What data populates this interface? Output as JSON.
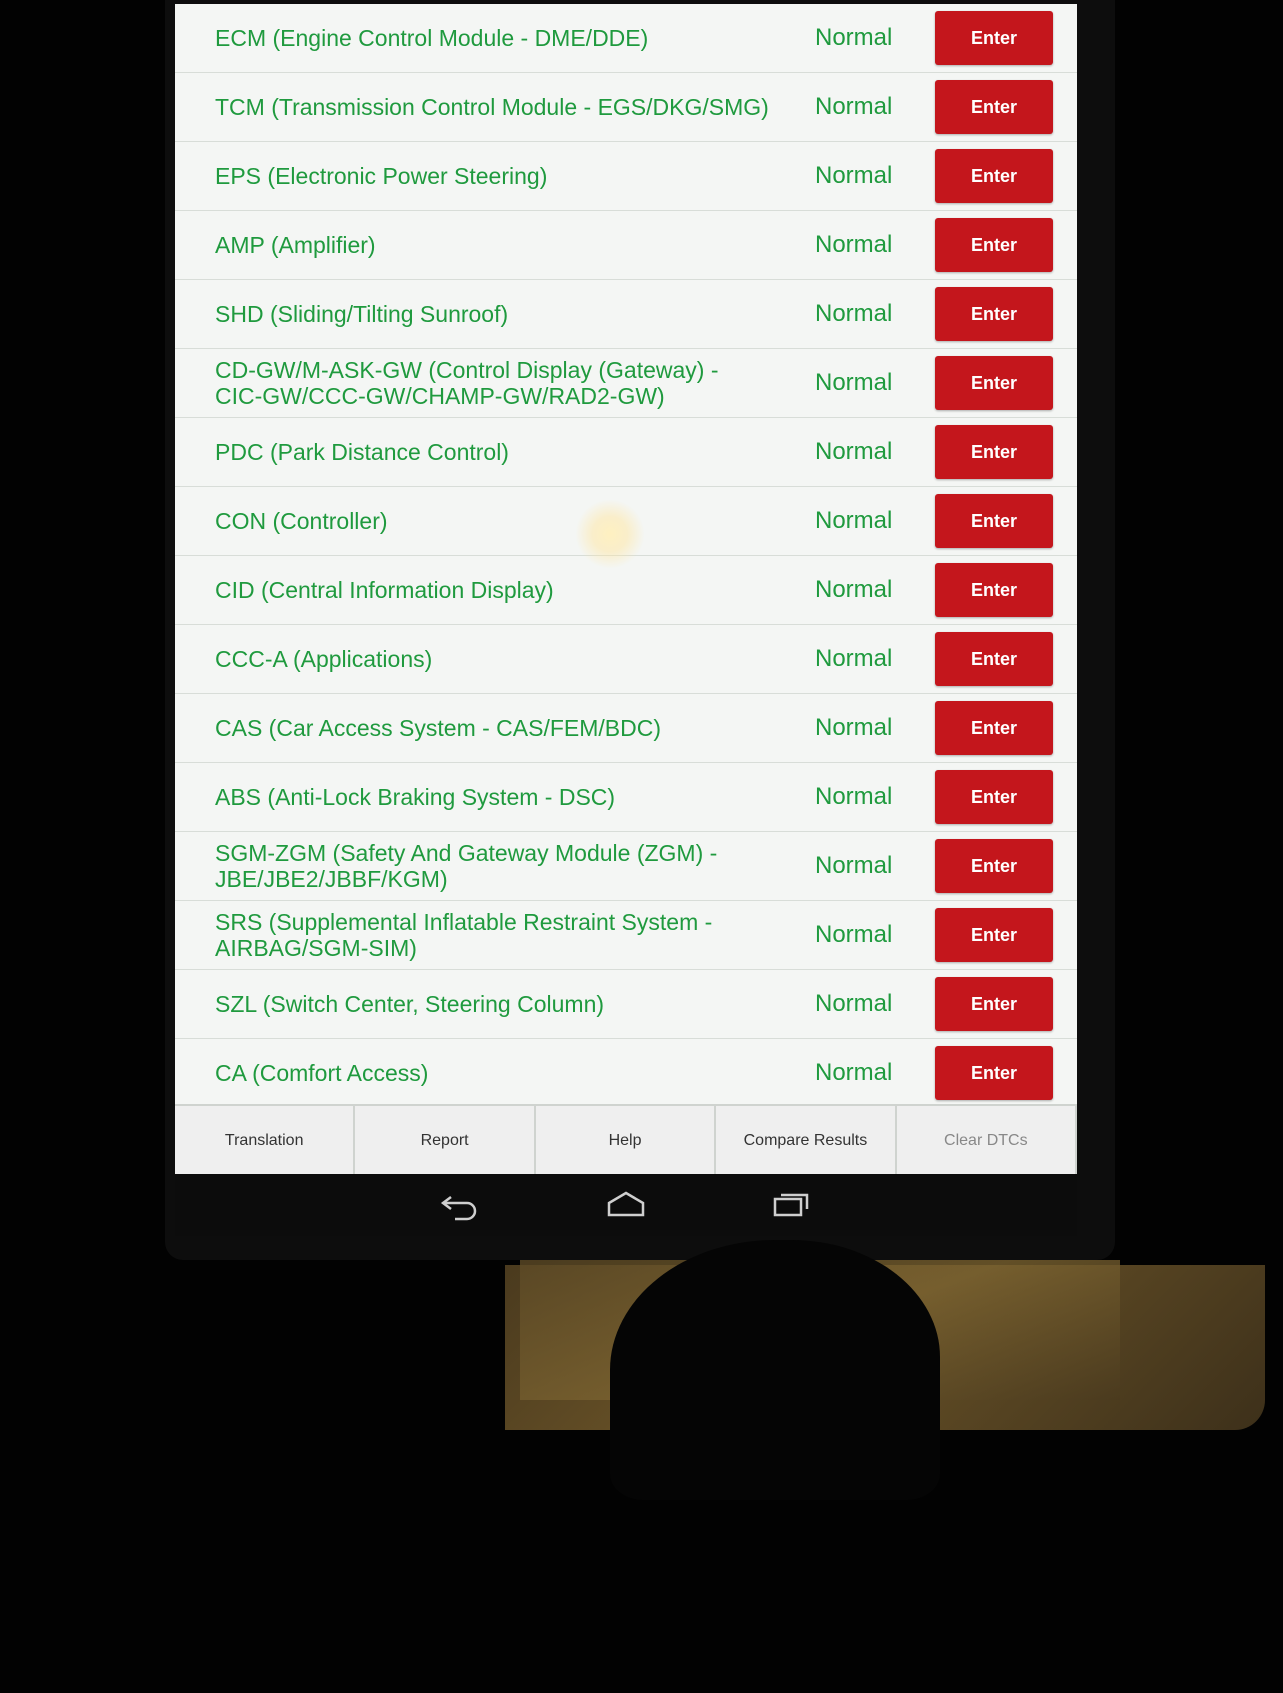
{
  "modules": [
    {
      "name": "ECM (Engine Control Module - DME/DDE)",
      "status": "Normal",
      "action": "Enter"
    },
    {
      "name": "TCM (Transmission Control Module - EGS/DKG/SMG)",
      "status": "Normal",
      "action": "Enter"
    },
    {
      "name": "EPS (Electronic Power Steering)",
      "status": "Normal",
      "action": "Enter"
    },
    {
      "name": "AMP (Amplifier)",
      "status": "Normal",
      "action": "Enter"
    },
    {
      "name": "SHD (Sliding/Tilting Sunroof)",
      "status": "Normal",
      "action": "Enter"
    },
    {
      "name": "CD-GW/M-ASK-GW (Control Display (Gateway) - CIC-GW/CCC-GW/CHAMP-GW/RAD2-GW)",
      "status": "Normal",
      "action": "Enter"
    },
    {
      "name": "PDC (Park Distance Control)",
      "status": "Normal",
      "action": "Enter"
    },
    {
      "name": "CON (Controller)",
      "status": "Normal",
      "action": "Enter"
    },
    {
      "name": "CID (Central Information Display)",
      "status": "Normal",
      "action": "Enter"
    },
    {
      "name": "CCC-A (Applications)",
      "status": "Normal",
      "action": "Enter"
    },
    {
      "name": "CAS (Car Access System - CAS/FEM/BDC)",
      "status": "Normal",
      "action": "Enter"
    },
    {
      "name": "ABS (Anti-Lock Braking System - DSC)",
      "status": "Normal",
      "action": "Enter"
    },
    {
      "name": "SGM-ZGM (Safety And Gateway Module (ZGM) - JBE/JBE2/JBBF/KGM)",
      "status": "Normal",
      "action": "Enter"
    },
    {
      "name": "SRS (Supplemental Inflatable Restraint System - AIRBAG/SGM-SIM)",
      "status": "Normal",
      "action": "Enter"
    },
    {
      "name": "SZL (Switch Center, Steering Column)",
      "status": "Normal",
      "action": "Enter"
    },
    {
      "name": "CA (Comfort Access)",
      "status": "Normal",
      "action": "Enter"
    }
  ],
  "toolbar": {
    "translation": "Translation",
    "report": "Report",
    "help": "Help",
    "compare": "Compare Results",
    "clear": "Clear DTCs"
  },
  "navbar": {
    "icons": [
      "back-icon",
      "home-icon",
      "recent-apps-icon"
    ]
  },
  "colors": {
    "status_text": "#1f9a3e",
    "enter_button": "#c4161c",
    "screen_bg": "#f4f6f4"
  }
}
